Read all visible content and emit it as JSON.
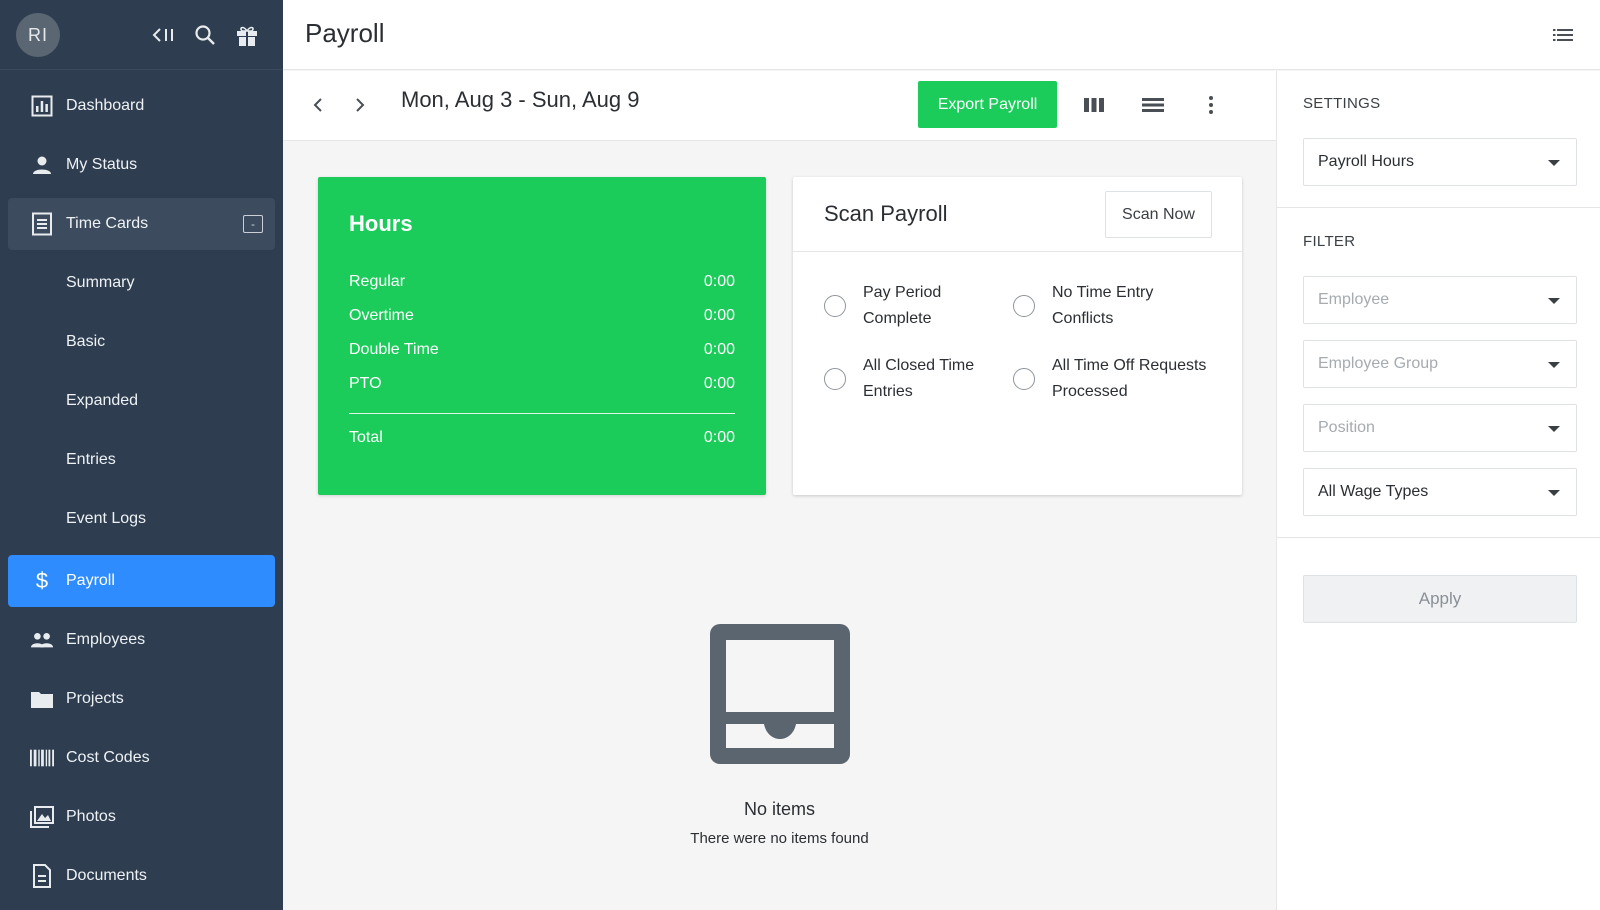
{
  "user": {
    "initials": "RI"
  },
  "sidebar": {
    "items": [
      {
        "label": "Dashboard"
      },
      {
        "label": "My Status"
      },
      {
        "label": "Time Cards",
        "collapse_symbol": "-"
      },
      {
        "label": "Summary"
      },
      {
        "label": "Basic"
      },
      {
        "label": "Expanded"
      },
      {
        "label": "Entries"
      },
      {
        "label": "Event Logs"
      },
      {
        "label": "Payroll"
      },
      {
        "label": "Employees"
      },
      {
        "label": "Projects"
      },
      {
        "label": "Cost Codes"
      },
      {
        "label": "Photos"
      },
      {
        "label": "Documents"
      }
    ]
  },
  "header": {
    "title": "Payroll"
  },
  "toolbar": {
    "date_range": "Mon, Aug 3 - Sun, Aug 9",
    "export_label": "Export Payroll"
  },
  "hours": {
    "title": "Hours",
    "rows": [
      {
        "label": "Regular",
        "value": "0:00"
      },
      {
        "label": "Overtime",
        "value": "0:00"
      },
      {
        "label": "Double Time",
        "value": "0:00"
      },
      {
        "label": "PTO",
        "value": "0:00"
      }
    ],
    "total": {
      "label": "Total",
      "value": "0:00"
    }
  },
  "scan": {
    "title": "Scan Payroll",
    "button_label": "Scan Now",
    "checks": [
      {
        "label": "Pay Period Complete"
      },
      {
        "label": "No Time Entry Conflicts"
      },
      {
        "label": "All Closed Time Entries"
      },
      {
        "label": "All Time Off Requests Processed"
      }
    ]
  },
  "empty": {
    "title": "No items",
    "subtitle": "There were no items found"
  },
  "settings": {
    "label": "SETTINGS",
    "report_type": "Payroll Hours"
  },
  "filter": {
    "label": "FILTER",
    "employee_placeholder": "Employee",
    "group_placeholder": "Employee Group",
    "position_placeholder": "Position",
    "wage_type": "All Wage Types",
    "apply_label": "Apply"
  },
  "colors": {
    "sidebar": "#2e3d4f",
    "active": "#2f8cff",
    "green": "#1ccc5b"
  }
}
